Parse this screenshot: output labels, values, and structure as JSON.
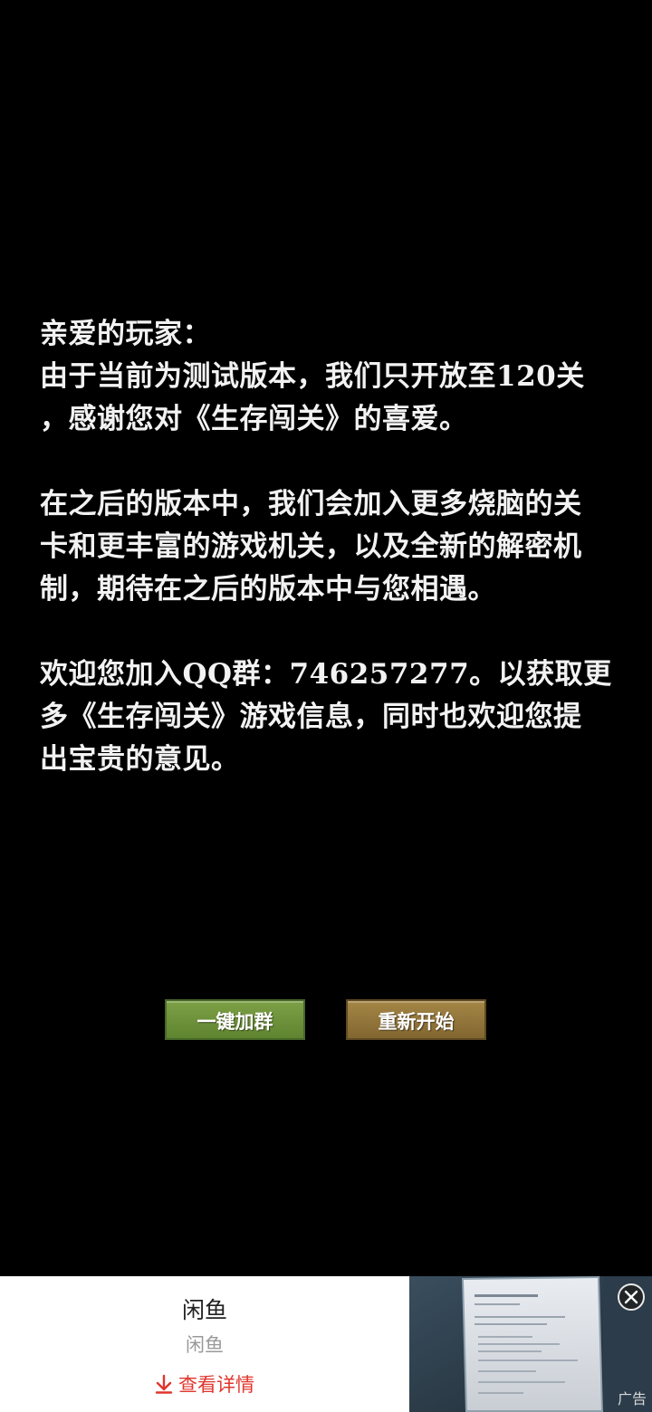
{
  "letter": {
    "greeting": "亲爱的玩家：",
    "para1": [
      "由于当前为测试版本，我们只开放至120关",
      "，感谢您对《生存闯关》的喜爱。"
    ],
    "para2": [
      "在之后的版本中，我们会加入更多烧脑的关",
      "卡和更丰富的游戏机关，以及全新的解密机",
      "制，期待在之后的版本中与您相遇。"
    ],
    "para3": [
      "欢迎您加入QQ群：746257277。以获取更",
      "多《生存闯关》游戏信息，同时也欢迎您提",
      "出宝贵的意见。"
    ]
  },
  "buttons": {
    "join_group": "一键加群",
    "restart": "重新开始"
  },
  "ad": {
    "title": "闲鱼",
    "subtitle": "闲鱼",
    "cta": "查看详情",
    "label": "广告",
    "close_icon": "close-icon",
    "download_icon": "download-icon"
  },
  "colors": {
    "background": "#000000",
    "text": "#f2f2f2",
    "join_button": "#6f9339",
    "restart_button": "#93773b",
    "cta": "#e0362c"
  }
}
